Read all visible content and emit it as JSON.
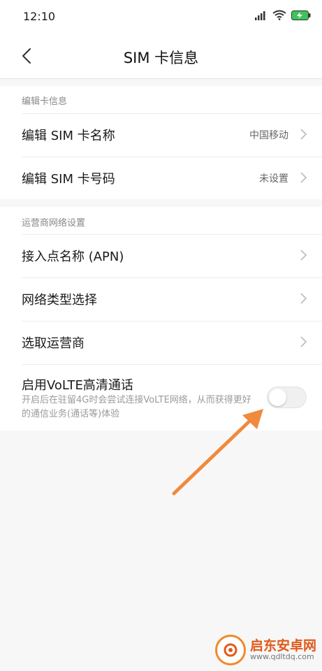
{
  "status_bar": {
    "time": "12:10",
    "icons": [
      "signal-icon",
      "wifi-icon",
      "battery-charging-icon"
    ]
  },
  "header": {
    "title": "SIM 卡信息",
    "back_icon": "chevron-left-icon"
  },
  "sections": [
    {
      "header": "编辑卡信息",
      "rows": [
        {
          "label": "编辑 SIM 卡名称",
          "value": "中国移动"
        },
        {
          "label": "编辑 SIM 卡号码",
          "value": "未设置"
        }
      ]
    },
    {
      "header": "运营商网络设置",
      "rows": [
        {
          "label": "接入点名称 (APN)"
        },
        {
          "label": "网络类型选择"
        },
        {
          "label": "选取运营商"
        }
      ],
      "volte": {
        "title": "启用VoLTE高清通话",
        "description": "开启后在驻留4G时会尝试连接VoLTE网络，从而获得更好的通信业务(通话等)体验",
        "enabled": false
      }
    }
  ],
  "annotation": {
    "arrow_color": "#f08a3c"
  },
  "watermark": {
    "text": "启东安卓网",
    "url": "www.qdltdq.com"
  }
}
